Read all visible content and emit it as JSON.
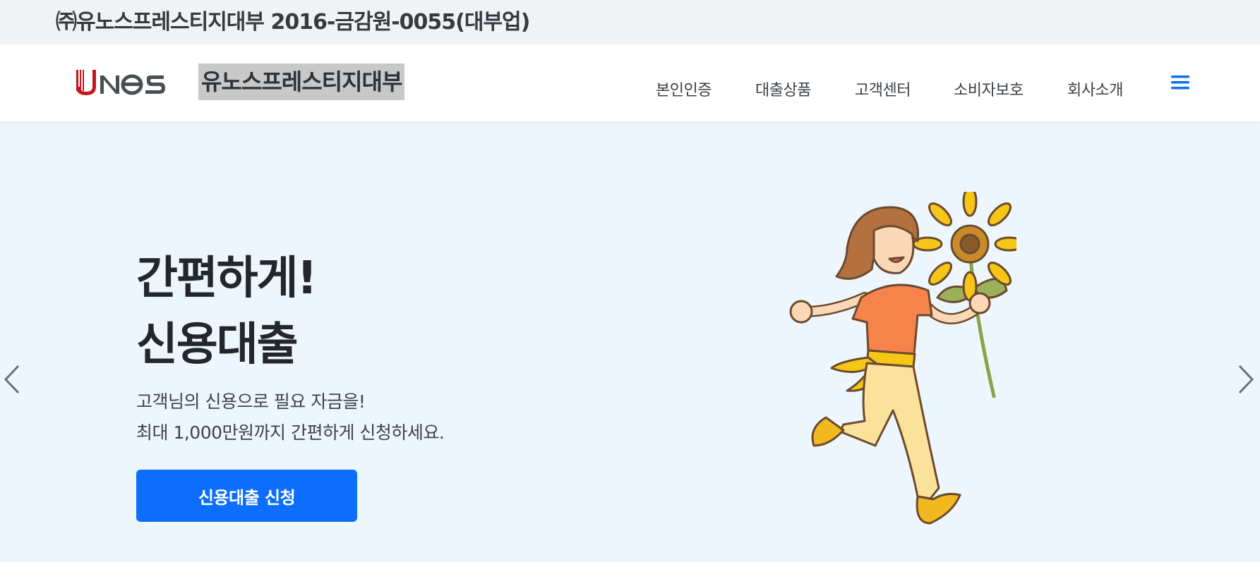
{
  "topbar": {
    "company_registration": "㈜유노스프레스티지대부 2016-금감원-0055(대부업)"
  },
  "header": {
    "logo_icon": "unos-logo",
    "brand_name": "유노스프레스티지대부",
    "nav": [
      {
        "label": "본인인증"
      },
      {
        "label": "대출상품"
      },
      {
        "label": "고객센터"
      },
      {
        "label": "소비자보호"
      },
      {
        "label": "회사소개"
      }
    ],
    "menu_icon": "hamburger-menu-icon"
  },
  "hero": {
    "title_line1": "간편하게!",
    "title_line2": "신용대출",
    "subtitle_line1": "고객님의 신용으로 필요 자금을!",
    "subtitle_line2": "최대 1,000만원까지 간편하게 신청하세요.",
    "cta_label": "신용대출 신청",
    "prev_icon": "chevron-left-icon",
    "next_icon": "chevron-right-icon",
    "illustration": "woman-running-with-sunflower"
  },
  "colors": {
    "accent": "#0d6efd",
    "hero_background": "#eef6fd",
    "topbar_background": "#f1f2f4",
    "logo_red": "#c4161c",
    "logo_gray": "#4a4f55"
  }
}
